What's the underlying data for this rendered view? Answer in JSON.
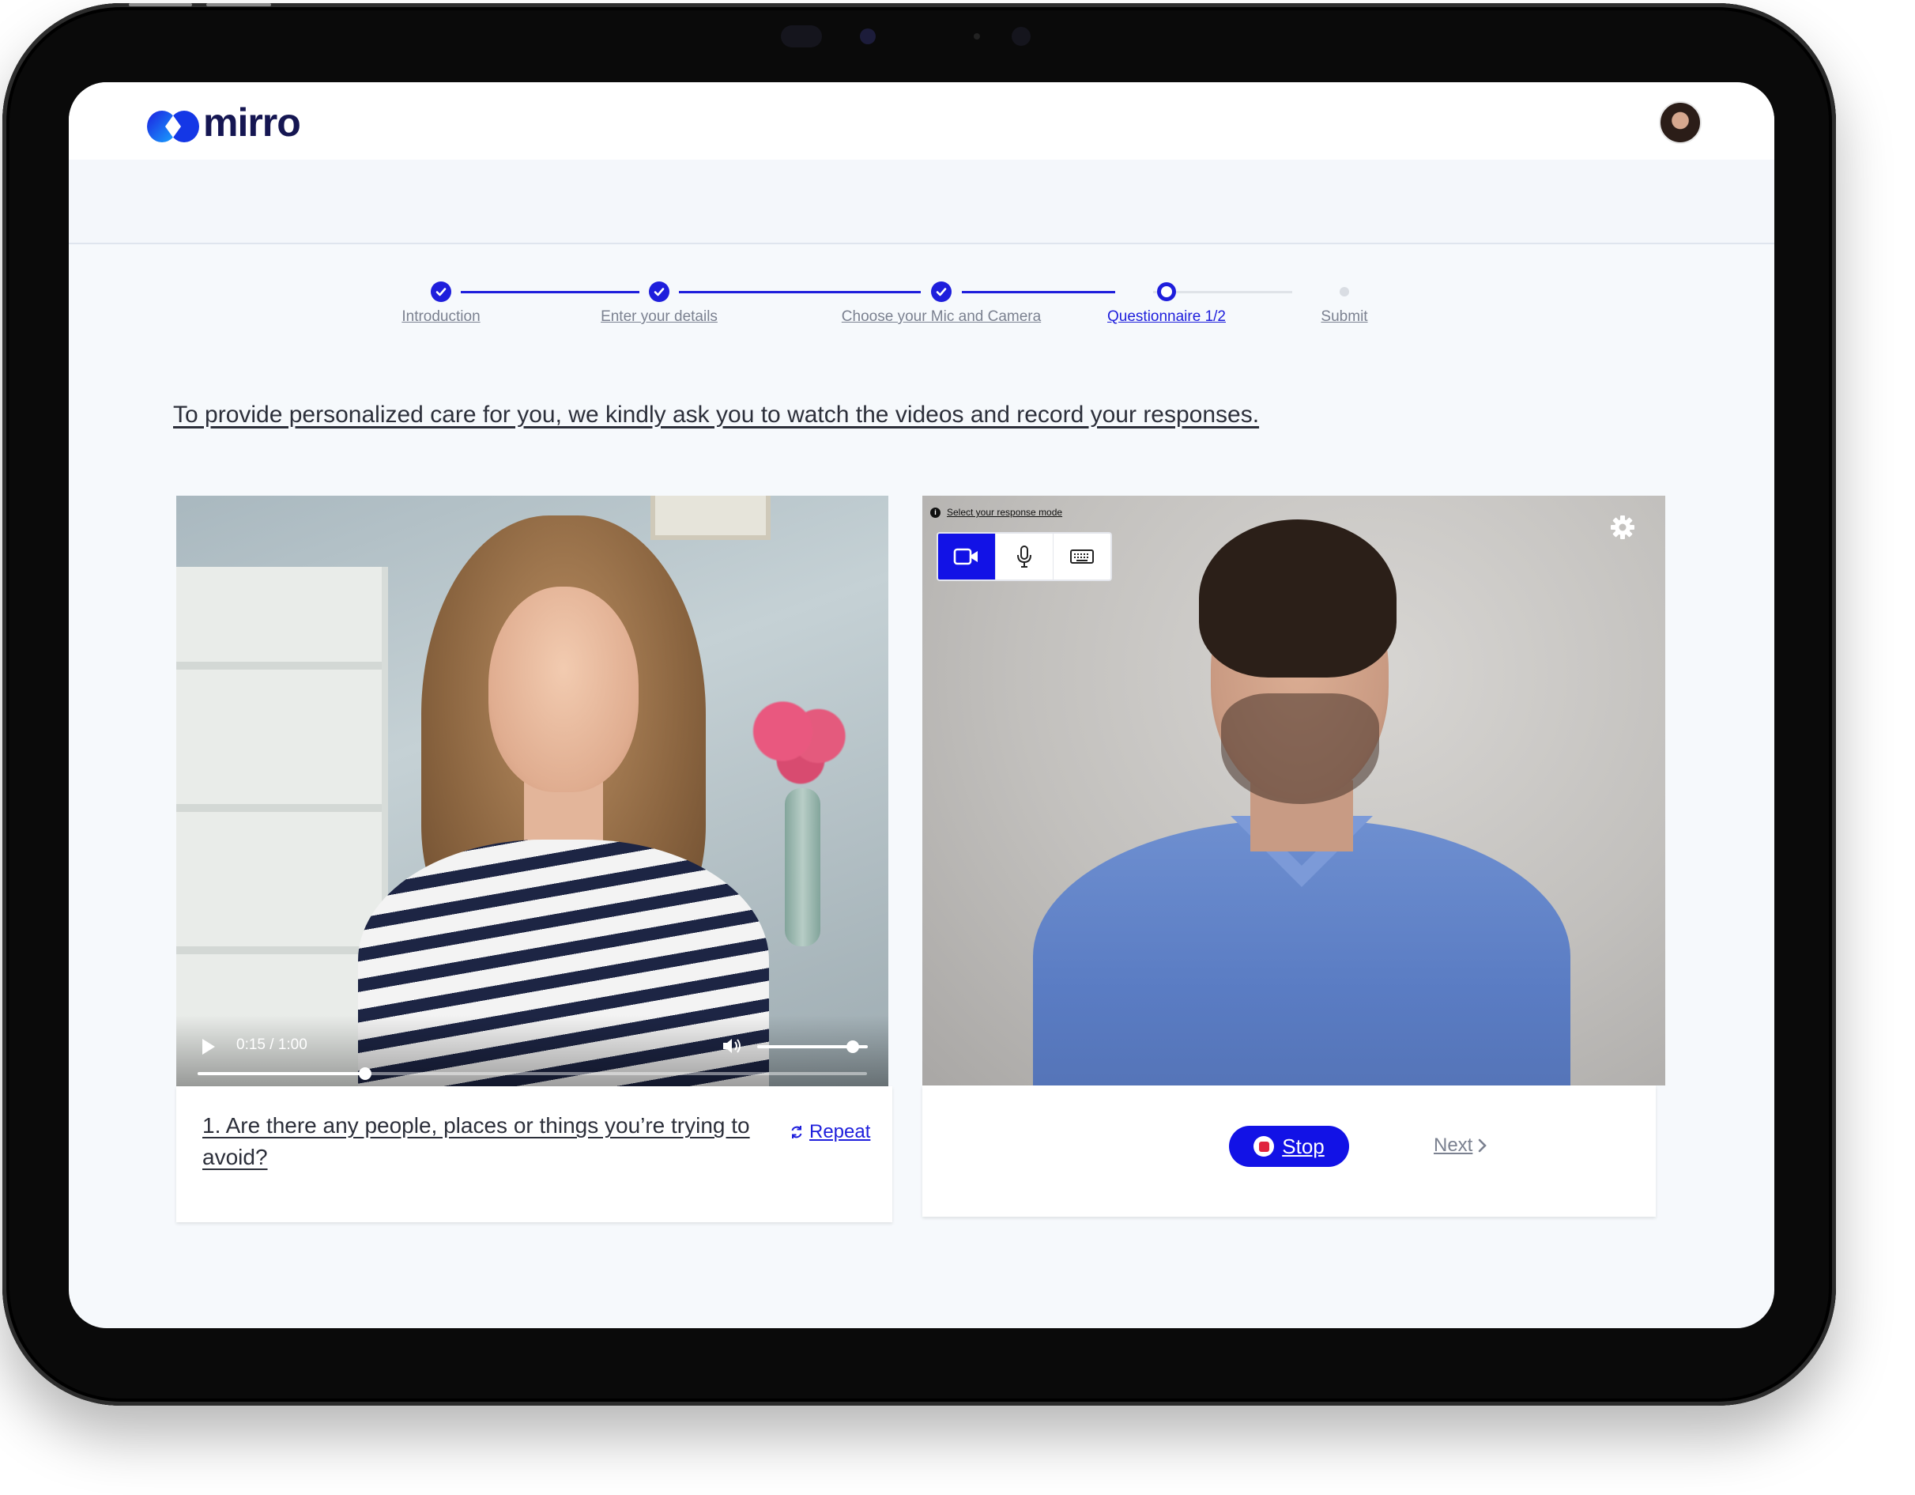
{
  "app": {
    "logo_text": "mirro",
    "brand_color": "#1212e6"
  },
  "user": {
    "avatar_icon": "user-avatar"
  },
  "stepper": {
    "steps": [
      {
        "label": "Introduction",
        "status": "done"
      },
      {
        "label": "Enter your details",
        "status": "done"
      },
      {
        "label": "Choose your Mic and Camera",
        "status": "done"
      },
      {
        "label": "Questionnaire 1/2",
        "status": "current"
      },
      {
        "label": "Submit",
        "status": "todo"
      }
    ]
  },
  "intro_text": "To provide personalized care for you, we kindly ask you to watch the videos and record your responses.",
  "question_video": {
    "time": "0:15 / 1:00",
    "progress": 0.25,
    "volume": 0.85
  },
  "question": {
    "text": "1. Are there any people, places or things you’re trying to avoid?",
    "repeat_label": "Repeat"
  },
  "response": {
    "mode_label": "Select your response mode",
    "modes": [
      {
        "icon": "video-camera-icon",
        "active": true
      },
      {
        "icon": "microphone-icon",
        "active": false
      },
      {
        "icon": "keyboard-icon",
        "active": false
      }
    ],
    "stop_label": "Stop",
    "next_label": "Next"
  }
}
